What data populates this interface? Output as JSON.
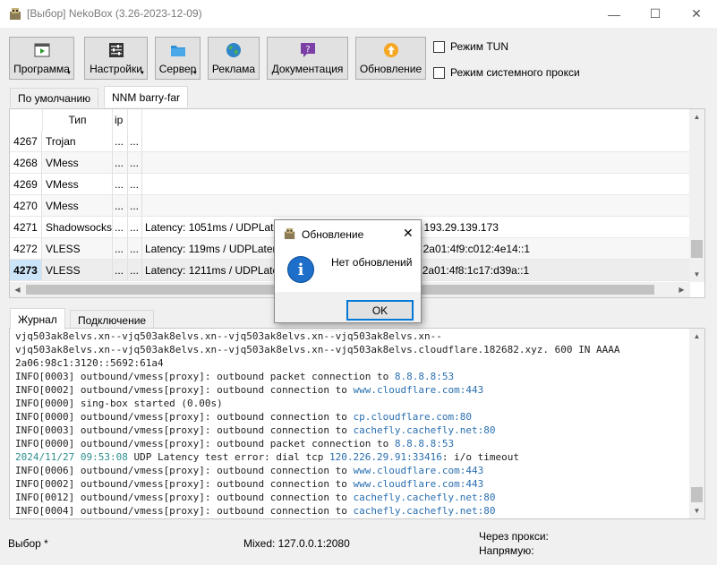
{
  "window": {
    "title": "[Выбор] NekoBox (3.26-2023-12-09)",
    "minimize_glyph": "—",
    "maximize_glyph": "☐",
    "close_glyph": "✕"
  },
  "toolbar": {
    "program": "Программа",
    "settings": "Настройки",
    "server": "Сервер",
    "ads": "Реклама",
    "docs": "Документация",
    "update": "Обновление"
  },
  "options": {
    "tun_mode": "Режим TUN",
    "system_proxy": "Режим системного прокси"
  },
  "group_tabs": [
    "По умолчанию",
    "NNM barry-far"
  ],
  "table": {
    "header_type": "Тип",
    "header_a": "ip",
    "rows": [
      {
        "id": "4267",
        "type": "Trojan",
        "a": "...",
        "b": "...",
        "info": ""
      },
      {
        "id": "4268",
        "type": "VMess",
        "a": "...",
        "b": "...",
        "info": ""
      },
      {
        "id": "4269",
        "type": "VMess",
        "a": "...",
        "b": "...",
        "info": ""
      },
      {
        "id": "4270",
        "type": "VMess",
        "a": "...",
        "b": "...",
        "info": ""
      },
      {
        "id": "4271",
        "type": "Shadowsocks",
        "a": "...",
        "b": "...",
        "info": "Latency: 1051ms / UDPLatency:                                             / In: 45.87.175.199 / Out: 193.29.139.173"
      },
      {
        "id": "4272",
        "type": "VLESS",
        "a": "...",
        "b": "...",
        "info": "Latency: 119ms / UDPLatency:                                               / In: 185.146.173.58 / Out: 2a01:4f9:c012:4e14::1"
      },
      {
        "id": "4273",
        "type": "VLESS",
        "a": "...",
        "b": "...",
        "info": "Latency: 1211ms / UDPLatency:                                             / In: 79.127.70.115 / Out: 2a01:4f8:1c17:d39a::1"
      }
    ]
  },
  "log_tabs": [
    "Журнал",
    "Подключение"
  ],
  "log": [
    {
      "text": "vjq503ak8elvs.xn--vjq503ak8elvs.xn--vjq503ak8elvs.xn--vjq503ak8elvs.xn--",
      "hl": "",
      "rest": ""
    },
    {
      "text": "vjq503ak8elvs.xn--vjq503ak8elvs.xn--vjq503ak8elvs.xn--vjq503ak8elvs.cloudflare.182682.xyz. 600 IN AAAA",
      "hl": "",
      "rest": ""
    },
    {
      "text": "2a06:98c1:3120::5692:61a4",
      "hl": "",
      "rest": ""
    },
    {
      "text": "INFO[0003] outbound/vmess[proxy]: outbound packet connection to ",
      "hl": "8.8.8.8:53",
      "rest": ""
    },
    {
      "text": "INFO[0002] outbound/vmess[proxy]: outbound connection to ",
      "hl": "www.cloudflare.com:443",
      "rest": ""
    },
    {
      "text": "INFO[0000] sing-box started (0.00s)",
      "hl": "",
      "rest": ""
    },
    {
      "text": "INFO[0000] outbound/vmess[proxy]: outbound connection to ",
      "hl": "cp.cloudflare.com:80",
      "rest": ""
    },
    {
      "text": "INFO[0003] outbound/vmess[proxy]: outbound connection to ",
      "hl": "cachefly.cachefly.net:80",
      "rest": ""
    },
    {
      "text": "INFO[0000] outbound/vmess[proxy]: outbound packet connection to ",
      "hl": "8.8.8.8:53",
      "rest": ""
    },
    {
      "ts": "2024/11/27 09:53:08",
      "text": " UDP Latency test error: dial tcp ",
      "hl": "120.226.29.91:33416",
      "rest": ": i/o timeout"
    },
    {
      "text": "INFO[0006] outbound/vmess[proxy]: outbound connection to ",
      "hl": "www.cloudflare.com:443",
      "rest": ""
    },
    {
      "text": "INFO[0002] outbound/vmess[proxy]: outbound connection to ",
      "hl": "www.cloudflare.com:443",
      "rest": ""
    },
    {
      "text": "INFO[0012] outbound/vmess[proxy]: outbound connection to ",
      "hl": "cachefly.cachefly.net:80",
      "rest": ""
    },
    {
      "text": "INFO[0004] outbound/vmess[proxy]: outbound connection to ",
      "hl": "cachefly.cachefly.net:80",
      "rest": ""
    }
  ],
  "status": {
    "selection": "Выбор *",
    "mixed": "Mixed: 127.0.0.1:2080",
    "via_proxy": "Через прокси:",
    "direct": "Напрямую:"
  },
  "dialog": {
    "title": "Обновление",
    "message": "Нет обновлений",
    "ok": "OK",
    "close_glyph": "✕",
    "info_glyph": "i"
  },
  "colors": {
    "selection": "#cce4f7",
    "link": "#2a6fb0",
    "timestamp": "#2f8f8f",
    "accent": "#0078d7"
  }
}
